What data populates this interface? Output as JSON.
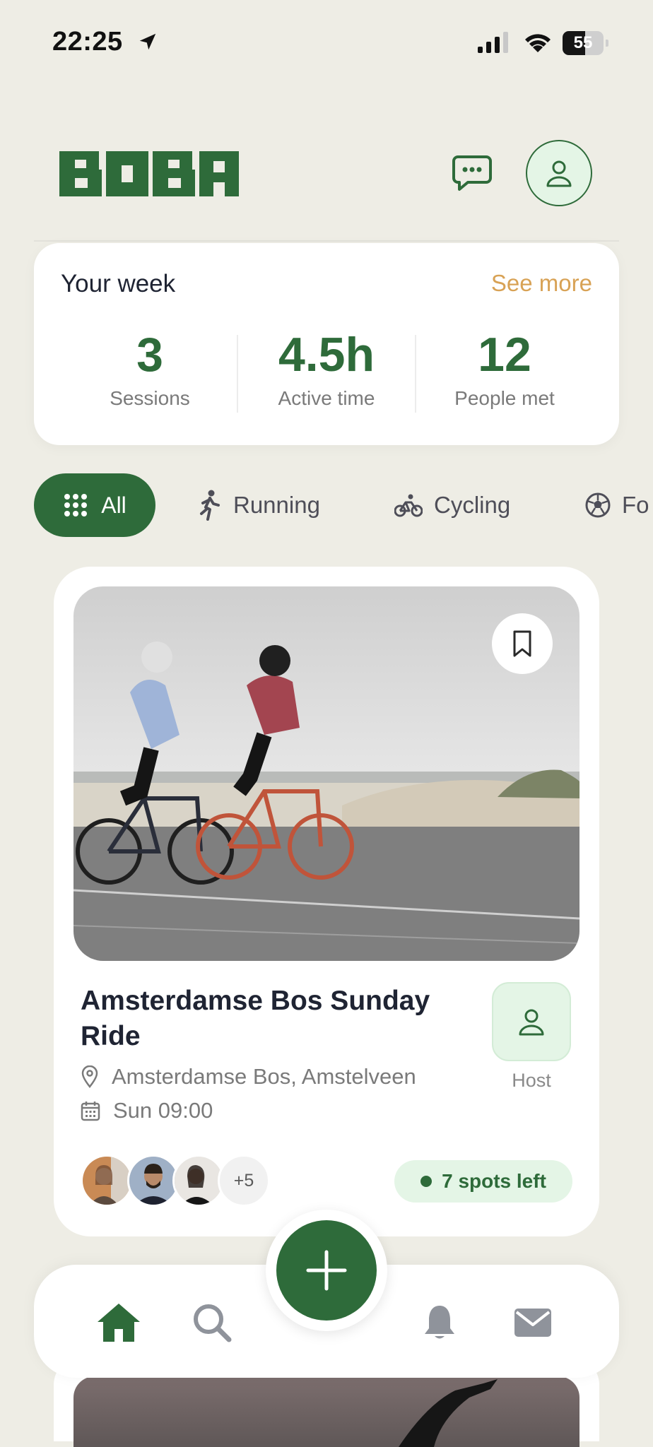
{
  "status_bar": {
    "time": "22:25",
    "battery": "55",
    "battery_level": 0.55
  },
  "header": {
    "logo_text": "BOBA"
  },
  "week": {
    "title": "Your week",
    "see_more": "See more",
    "stats": [
      {
        "value": "3",
        "label": "Sessions"
      },
      {
        "value": "4.5h",
        "label": "Active time"
      },
      {
        "value": "12",
        "label": "People met"
      }
    ]
  },
  "filters": {
    "selected": "All",
    "items": [
      {
        "label": "All",
        "icon": "grid-icon"
      },
      {
        "label": "Running",
        "icon": "runner-icon"
      },
      {
        "label": "Cycling",
        "icon": "bicycle-icon"
      },
      {
        "label": "Fo",
        "icon": "football-icon"
      }
    ]
  },
  "event": {
    "title": "Amsterdamse Bos Sunday Ride",
    "location": "Amsterdamse Bos, Amstelveen",
    "time": "Sun 09:00",
    "host_label": "Host",
    "more_attendees": "+5",
    "spots": "7 spots left"
  },
  "colors": {
    "brand": "#2e6b3a",
    "accent": "#d8a255",
    "mint": "#e4f5e6",
    "background": "#eeede5"
  },
  "nav": {
    "items": [
      "home-icon",
      "search-icon",
      "add-icon",
      "bell-icon",
      "mail-icon"
    ],
    "active": "home-icon"
  }
}
